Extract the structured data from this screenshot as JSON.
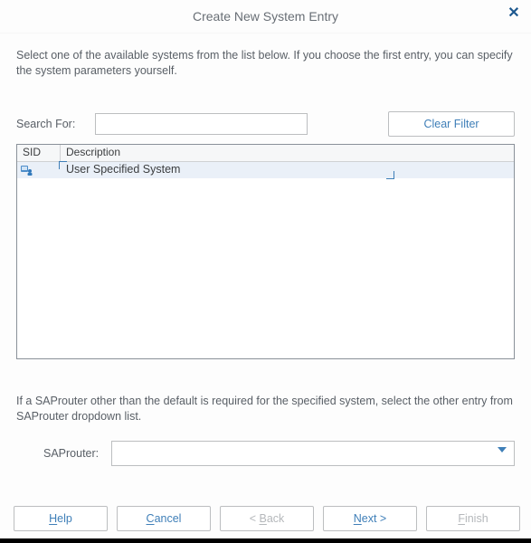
{
  "title": "Create New System Entry",
  "description": "Select one of the available systems from the list below. If you choose the first entry, you can specify the system parameters yourself.",
  "search": {
    "label": "Search For:",
    "value": "",
    "placeholder": ""
  },
  "clear_filter_label": "Clear Filter",
  "table": {
    "headers": {
      "sid": "SID",
      "description": "Description"
    },
    "rows": [
      {
        "sid_icon": "user-system-icon",
        "description": "User Specified System",
        "selected": true
      }
    ]
  },
  "saprouter_note": "If a SAProuter other than the default is required for the specified system, select the other entry from SAProuter dropdown list.",
  "saprouter": {
    "label": "SAProuter:",
    "value": ""
  },
  "buttons": {
    "help": {
      "label": "Help",
      "mnemonic_index": 0,
      "enabled": true
    },
    "cancel": {
      "label": "Cancel",
      "mnemonic_index": 0,
      "enabled": true
    },
    "back": {
      "label": "< Back",
      "mnemonic_index": 2,
      "enabled": false
    },
    "next": {
      "label": "Next >",
      "mnemonic_index": 0,
      "enabled": true
    },
    "finish": {
      "label": "Finish",
      "mnemonic_index": 0,
      "enabled": false
    }
  }
}
